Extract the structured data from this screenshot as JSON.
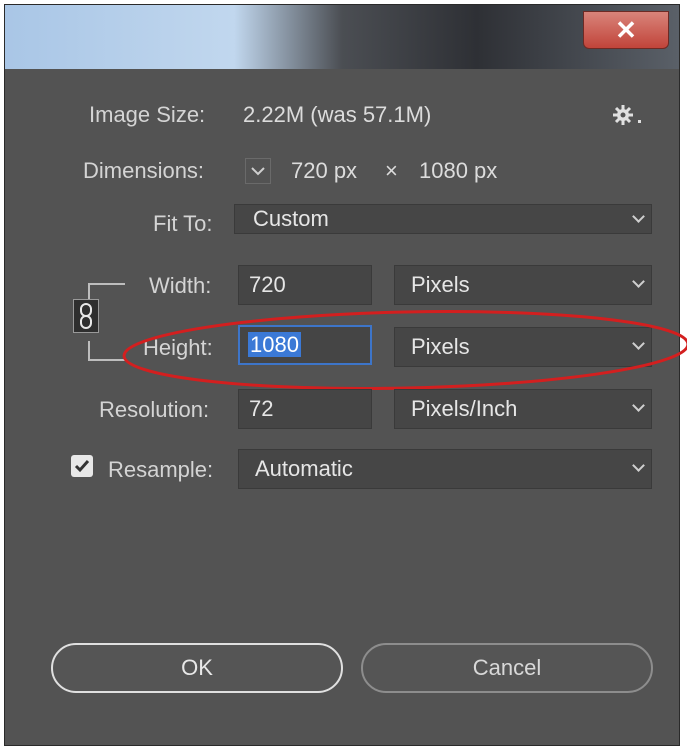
{
  "window": {
    "close_glyph": "✕"
  },
  "image_size": {
    "label": "Image Size:",
    "value": "2.22M (was 57.1M)",
    "menu_icon": "gear-icon"
  },
  "dimensions": {
    "label": "Dimensions:",
    "width": "720 px",
    "times": "×",
    "height": "1080 px"
  },
  "fit_to": {
    "label": "Fit To:",
    "value": "Custom"
  },
  "width": {
    "label": "Width:",
    "value": "720",
    "unit": "Pixels"
  },
  "height": {
    "label": "Height:",
    "value": "1080",
    "unit": "Pixels"
  },
  "resolution": {
    "label": "Resolution:",
    "value": "72",
    "unit": "Pixels/Inch"
  },
  "resample": {
    "label": "Resample:",
    "checked": true,
    "value": "Automatic"
  },
  "buttons": {
    "ok": "OK",
    "cancel": "Cancel"
  },
  "colors": {
    "dialog_bg": "#535353",
    "highlight": "#3b79d6",
    "annotation": "#d31f1f",
    "close_button": "#c1443a"
  }
}
